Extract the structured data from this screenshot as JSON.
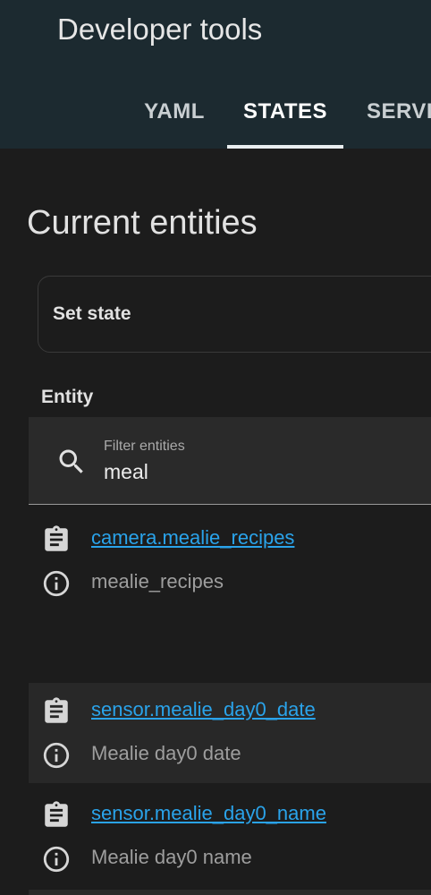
{
  "header": {
    "title": "Developer tools",
    "tabs": [
      {
        "label": "YAML"
      },
      {
        "label": "STATES"
      },
      {
        "label": "SERVIC"
      }
    ],
    "active_tab": "STATES"
  },
  "main": {
    "title": "Current entities",
    "set_state": {
      "label": "Set state"
    },
    "column_header": "Entity",
    "filter": {
      "label": "Filter entities",
      "value": "meal"
    },
    "entities": [
      {
        "entity_id": "camera.mealie_recipes",
        "friendly_name": "mealie_recipes"
      },
      {
        "entity_id": "sensor.mealie_day0_date",
        "friendly_name": "Mealie day0 date"
      },
      {
        "entity_id": "sensor.mealie_day0_name",
        "friendly_name": "Mealie day0 name"
      }
    ]
  },
  "colors": {
    "header_bg": "#1c2a30",
    "page_bg": "#1c1c1c",
    "link": "#2aa3ea",
    "highlight_row": "#282828"
  },
  "icons": {
    "search": "magnify-icon",
    "copy": "clipboard-list-icon",
    "info": "information-outline-icon"
  }
}
